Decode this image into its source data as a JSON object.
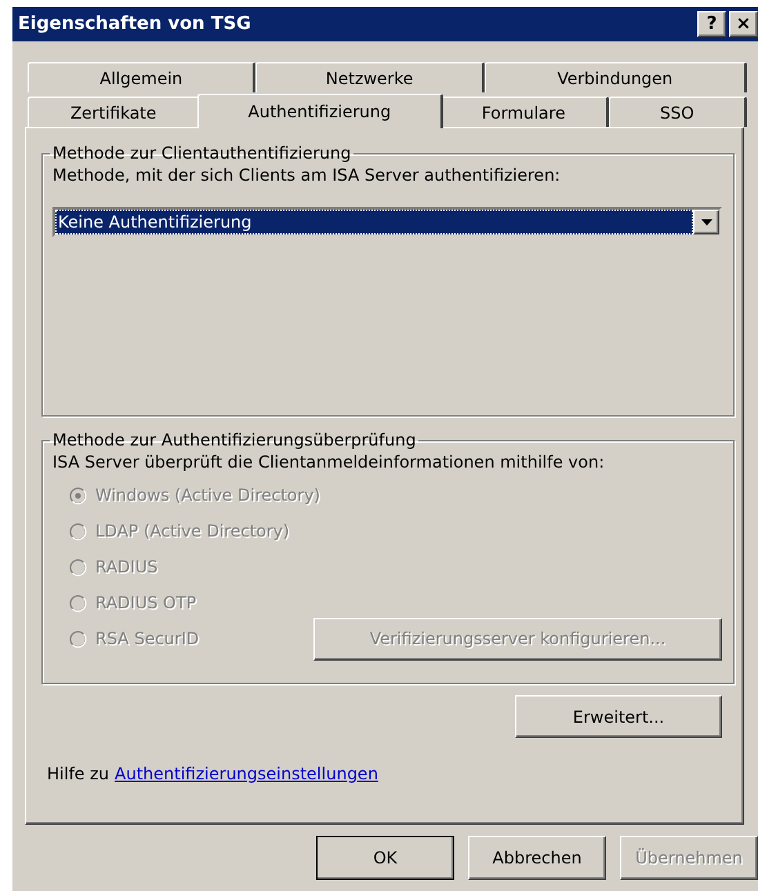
{
  "window": {
    "title": "Eigenschaften von TSG",
    "title_buttons": [
      "?",
      "×"
    ]
  },
  "tab_rows": [
    [
      {
        "label": "Allgemein",
        "selected": false
      },
      {
        "label": "Netzwerke",
        "selected": false
      },
      {
        "label": "Verbindungen",
        "selected": false
      }
    ],
    [
      {
        "label": "Zertifikate",
        "selected": false
      },
      {
        "label": "Authentifizierung",
        "selected": true
      },
      {
        "label": "Formulare",
        "selected": false
      },
      {
        "label": "SSO",
        "selected": false
      }
    ]
  ],
  "client_auth": {
    "title": "Methode zur Clientauthentifizierung",
    "prompt": "Methode, mit der sich Clients am ISA Server authentifizieren:",
    "dropdown": {
      "value": "Keine Authentifizierung",
      "focused": true
    }
  },
  "verification": {
    "title": "Methode zur Authentifizierungsüberprüfung",
    "prompt": "ISA Server überprüft die Clientanmeldeinformationen mithilfe von:",
    "options": [
      {
        "label": "Windows (Active Directory)",
        "selected": true,
        "disabled": true
      },
      {
        "label": "LDAP (Active Directory)",
        "selected": false,
        "disabled": true
      },
      {
        "label": "RADIUS",
        "selected": false,
        "disabled": true
      },
      {
        "label": "RADIUS OTP",
        "selected": false,
        "disabled": true
      },
      {
        "label": "RSA SecurID",
        "selected": false,
        "disabled": true
      }
    ],
    "configure_button": {
      "label": "Verifizierungsserver konfigurieren...",
      "disabled": true
    }
  },
  "advanced_button": {
    "label": "Erweitert...",
    "disabled": false
  },
  "help": {
    "text": "Hilfe zu",
    "link": "Authentifizierungseinstellungen"
  },
  "buttons": [
    {
      "label": "OK",
      "disabled": false,
      "default": true
    },
    {
      "label": "Abbrechen",
      "disabled": false,
      "default": false
    },
    {
      "label": "Übernehmen",
      "disabled": true,
      "default": false
    }
  ]
}
